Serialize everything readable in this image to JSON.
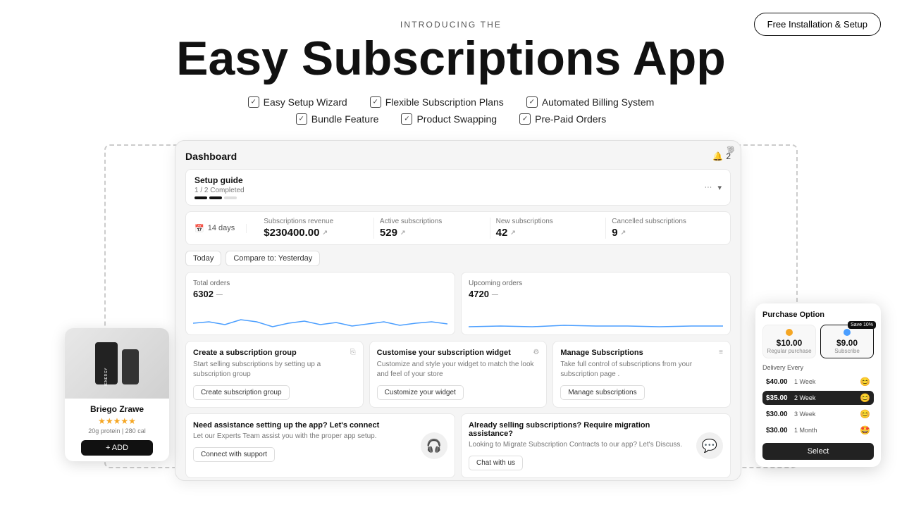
{
  "header": {
    "introducing": "INTRODUCING THE",
    "title": "Easy Subscriptions App",
    "cta": "Free Installation & Setup",
    "features_row1": [
      {
        "label": "Easy Setup Wizard"
      },
      {
        "label": "Flexible Subscription Plans"
      },
      {
        "label": "Automated Billing System"
      }
    ],
    "features_row2": [
      {
        "label": "Bundle Feature"
      },
      {
        "label": "Product Swapping"
      },
      {
        "label": "Pre-Paid Orders"
      }
    ]
  },
  "dashboard": {
    "title": "Dashboard",
    "notification_count": "2",
    "setup_guide": {
      "title": "Setup guide",
      "progress": "1 / 2 Completed",
      "more_label": "...",
      "chevron_label": "▾"
    },
    "stats": {
      "period": "14 days",
      "revenue_label": "Subscriptions revenue",
      "revenue_value": "$230400.00",
      "active_label": "Active subscriptions",
      "active_value": "529",
      "new_label": "New subscriptions",
      "new_value": "42",
      "cancelled_label": "Cancelled subscriptions",
      "cancelled_value": "9"
    },
    "date_buttons": [
      {
        "label": "Today"
      },
      {
        "label": "Compare to: Yesterday"
      }
    ],
    "charts": [
      {
        "title": "Total orders",
        "value": "6302"
      },
      {
        "title": "Upcoming orders",
        "value": "4720"
      }
    ],
    "action_cards": [
      {
        "title": "Create a subscription group",
        "desc": "Start selling subscriptions by setting up a subscription group",
        "btn": "Create subscription group"
      },
      {
        "title": "Customise your subscription widget",
        "desc": "Customize and style your widget to match the look and feel of your store",
        "btn": "Customize your widget"
      },
      {
        "title": "Manage Subscriptions",
        "desc": "Take full control of subscriptions from your subscription page .",
        "btn": "Manage subscriptions"
      }
    ],
    "support_cards": [
      {
        "title": "Need assistance setting up the app? Let's connect",
        "desc": "Let our Experts Team assist you with the proper app setup.",
        "btn": "Connect with support"
      },
      {
        "title": "Already selling subscriptions? Require migration assistance?",
        "desc": "Looking to Migrate Subscription Contracts to our app? Let's Discuss.",
        "btn": "Chat with us"
      }
    ]
  },
  "product_card": {
    "name": "Briego Zrawe",
    "stars": "★★★★★",
    "meta": "20g protein | 280 cal",
    "add_btn": "+ ADD"
  },
  "purchase_widget": {
    "title": "Purchase Option",
    "regular_price": "$10.00",
    "regular_label": "Regular purchase",
    "subscribe_price": "$9.00",
    "subscribe_label": "Subscribe",
    "save_label": "Save 10%",
    "delivery_title": "Delivery Every",
    "delivery_options": [
      {
        "price": "$40.00",
        "period": "1 Week",
        "emoji": "😊",
        "active": false
      },
      {
        "price": "$35.00",
        "period": "2 Week",
        "emoji": "😊",
        "active": true
      },
      {
        "price": "$30.00",
        "period": "3 Week",
        "emoji": "😊",
        "active": false
      },
      {
        "price": "$30.00",
        "period": "1 Month",
        "emoji": "🤩",
        "active": false
      }
    ],
    "select_btn": "Select"
  }
}
